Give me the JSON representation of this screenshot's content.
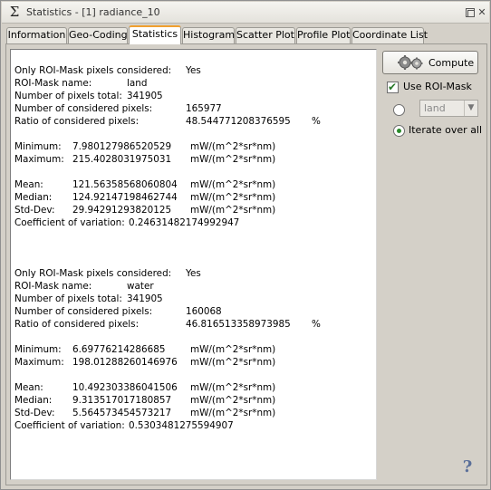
{
  "window": {
    "title": "Statistics - [1] radiance_10",
    "app_icon": "sigma-icon",
    "restore_icon": "restore-icon",
    "close_glyph": "✕"
  },
  "tabs": [
    {
      "label": "Information",
      "active": false
    },
    {
      "label": "Geo-Coding",
      "active": false
    },
    {
      "label": "Statistics",
      "active": true
    },
    {
      "label": "Histogram",
      "active": false
    },
    {
      "label": "Scatter Plot",
      "active": false
    },
    {
      "label": "Profile Plot",
      "active": false
    },
    {
      "label": "Coordinate List",
      "active": false
    }
  ],
  "labels": {
    "only_roi": "Only ROI-Mask pixels considered:",
    "roi_name": "ROI-Mask name:",
    "pixels_total": "Number of pixels total:",
    "considered": "Number of considered pixels:",
    "ratio": "Ratio of considered pixels:",
    "minimum": "Minimum:",
    "maximum": "Maximum:",
    "mean": "Mean:",
    "median": "Median:",
    "stddev": "Std-Dev:",
    "cv": "Coefficient of variation:",
    "unit": "mW/(m^2*sr*nm)",
    "percent": "%"
  },
  "blocks": [
    {
      "only_roi": "Yes",
      "roi_name": "land",
      "pixels_total": "341905",
      "considered": "165977",
      "ratio": "48.544771208376595",
      "minimum": "7.980127986520529",
      "maximum": "215.4028031975031",
      "mean": "121.56358568060804",
      "median": "124.92147198462744",
      "stddev": "29.94291293820125",
      "cv": "0.24631482174992947"
    },
    {
      "only_roi": "Yes",
      "roi_name": "water",
      "pixels_total": "341905",
      "considered": "160068",
      "ratio": "46.816513358973985",
      "minimum": "6.69776214286685",
      "maximum": "198.01288260146976",
      "mean": "10.492303386041506",
      "median": "9.313517017180857",
      "stddev": "5.564573454573217",
      "cv": "0.5303481275594907"
    }
  ],
  "controls": {
    "compute_label": "Compute",
    "compute_icon": "gears-icon",
    "use_roi_label": "Use ROI-Mask",
    "use_roi_checked": true,
    "roi_select_value": "land",
    "iterate_label": "Iterate over all",
    "iterate_selected": true,
    "help_glyph": "?"
  },
  "colors": {
    "active_tab_accent": "#f0a030",
    "check_green": "#2a8a2a",
    "help_blue": "#5a6f99"
  }
}
